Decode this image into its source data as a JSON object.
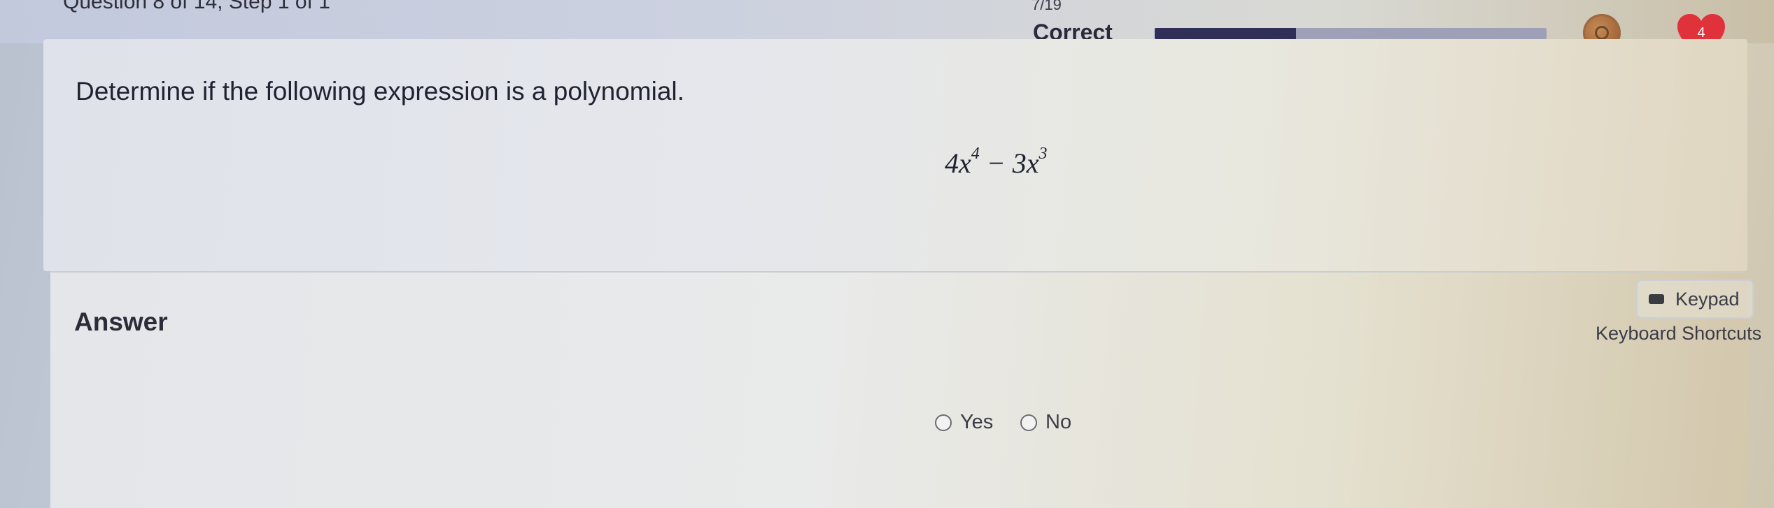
{
  "header": {
    "question_label": "Question 8 of 14, Step 1 of 1",
    "progress_count": "7/19",
    "progress_fraction": 0.36,
    "status": "Correct",
    "hearts": "4",
    "colors": {
      "progress_fill": "#2f2f57",
      "progress_track": "#9ea0b8",
      "heart": "#e0323a",
      "coin": "#a86a3c"
    }
  },
  "question": {
    "prompt": "Determine if the following expression is a polynomial.",
    "expression": {
      "coef1": "4",
      "var1": "x",
      "exp1": "4",
      "op": " − ",
      "coef2": "3",
      "var2": "x",
      "exp2": "3"
    }
  },
  "answer": {
    "title": "Answer",
    "keypad_label": "Keypad",
    "shortcuts_label": "Keyboard Shortcuts",
    "options": [
      "Yes",
      "No"
    ]
  }
}
